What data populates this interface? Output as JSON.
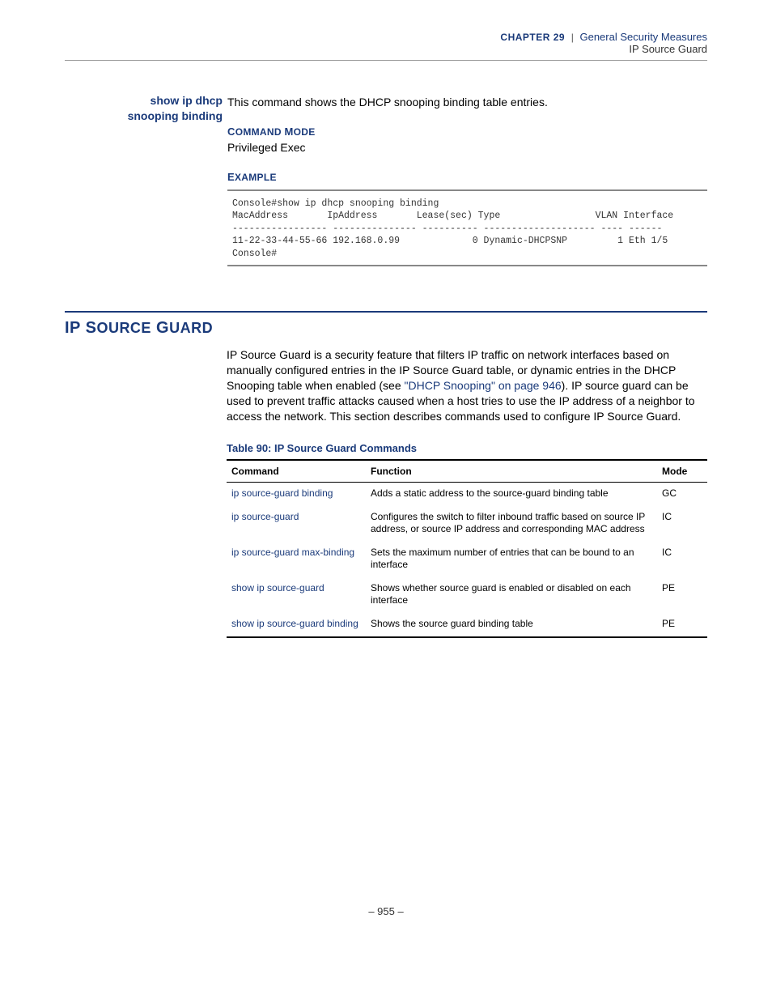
{
  "header": {
    "chapter_label_caps": "C",
    "chapter_label_rest": "HAPTER",
    "chapter_num": " 29",
    "sep": "|",
    "title": "General Security Measures",
    "subtitle": "IP Source Guard"
  },
  "command": {
    "name_line1": "show ip dhcp",
    "name_line2": "snooping binding",
    "desc": "This command shows the DHCP snooping binding table entries.",
    "mode_h_caps1": "C",
    "mode_h_rest1": "OMMAND",
    "mode_h_caps2": "M",
    "mode_h_rest2": "ODE",
    "mode_text": "Privileged Exec",
    "ex_h_caps": "E",
    "ex_h_rest": "XAMPLE",
    "example": "Console#show ip dhcp snooping binding\nMacAddress       IpAddress       Lease(sec) Type                 VLAN Interface\n----------------- --------------- ---------- -------------------- ---- ------\n11-22-33-44-55-66 192.168.0.99             0 Dynamic-DHCPSNP         1 Eth 1/5\nConsole#"
  },
  "section": {
    "title_caps1": "IP S",
    "title_rest1": "OURCE",
    "title_caps2": " G",
    "title_rest2": "UARD",
    "para_pre": "IP Source Guard is a security feature that filters IP traffic on network interfaces based on manually configured entries in the IP Source Guard table, or dynamic entries in the DHCP Snooping table when enabled (see ",
    "para_link": "\"DHCP Snooping\" on page 946",
    "para_post": "). IP source guard can be used to prevent traffic attacks caused when a host tries to use the IP address of a neighbor to access the network. This section describes commands used to configure IP Source Guard."
  },
  "table": {
    "caption": "Table 90: IP Source Guard Commands",
    "h_cmd": "Command",
    "h_func": "Function",
    "h_mode": "Mode",
    "rows": [
      {
        "cmd": "ip source-guard binding",
        "func": "Adds a static address to the source-guard binding table",
        "mode": "GC"
      },
      {
        "cmd": "ip source-guard",
        "func": "Configures the switch to filter inbound traffic based on source IP address, or source IP address and corresponding MAC address",
        "mode": "IC"
      },
      {
        "cmd": "ip source-guard max-binding",
        "func": "Sets the maximum number of entries that can be bound to an interface",
        "mode": "IC"
      },
      {
        "cmd": "show ip source-guard",
        "func": "Shows whether source guard is enabled or disabled on each interface",
        "mode": "PE"
      },
      {
        "cmd": "show ip source-guard binding",
        "func": "Shows the source guard binding table",
        "mode": "PE"
      }
    ]
  },
  "footer": {
    "page": "– 955 –"
  }
}
